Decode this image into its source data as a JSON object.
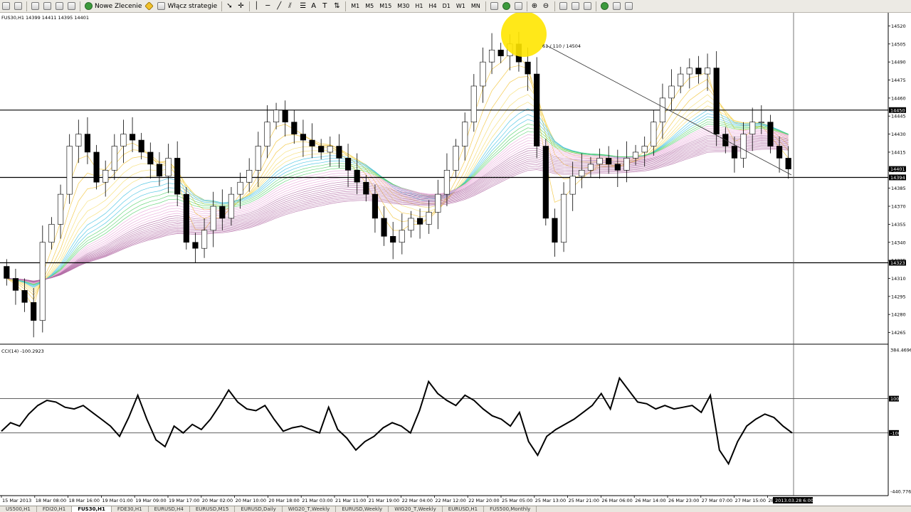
{
  "toolbar": {
    "new_order_label": "Nowe Zlecenie",
    "autotrading_label": "Włącz strategie",
    "timeframes": [
      "M1",
      "M5",
      "M15",
      "M30",
      "H1",
      "H4",
      "D1",
      "W1",
      "MN"
    ]
  },
  "main_chart": {
    "header": "FUS30,H1  14399 14411 14395 14401",
    "annotation": "61 / 110 / 14504",
    "price_ticks": [
      "14520",
      "14505",
      "14490",
      "14475",
      "14460",
      "14445",
      "14430",
      "14415",
      "14400",
      "14385",
      "14370",
      "14355",
      "14340",
      "14325",
      "14310",
      "14295",
      "14280",
      "14265"
    ],
    "price_tags": [
      "14450",
      "14401",
      "14394",
      "14323"
    ]
  },
  "indicator": {
    "header": "CCI(14) -100.2923",
    "ticks": [
      "384.4696",
      "100",
      "-100",
      "-440.7765"
    ]
  },
  "time_axis": {
    "labels": [
      "15 Mar 2013",
      "18 Mar 08:00",
      "18 Mar 16:00",
      "19 Mar 01:00",
      "19 Mar 09:00",
      "19 Mar 17:00",
      "20 Mar 02:00",
      "20 Mar 10:00",
      "20 Mar 18:00",
      "21 Mar 03:00",
      "21 Mar 11:00",
      "21 Mar 19:00",
      "22 Mar 04:00",
      "22 Mar 12:00",
      "22 Mar 20:00",
      "25 Mar 05:00",
      "25 Mar 13:00",
      "25 Mar 21:00",
      "26 Mar 06:00",
      "26 Mar 14:00",
      "26 Mar 23:00",
      "27 Mar 07:00",
      "27 Mar 15:00",
      "28"
    ],
    "cursor_label": "2013.03.28 6:00"
  },
  "tabs": [
    "US500,H1",
    "FDI20,H1",
    "FUS30,H1",
    "FDE30,H1",
    "EURUSD,H4",
    "EURUSD,M15",
    "EURUSD,Daily",
    "WIG20_T,Weekly",
    "EURUSD,Weekly",
    "WIG20_T,Weekly",
    "EURUSD,H1",
    "FUS500,Monthly"
  ],
  "active_tab": 2,
  "chart_data": {
    "type": "candlestick",
    "symbol": "FUS30",
    "timeframe": "H1",
    "ylim": [
      14260,
      14525
    ],
    "horizontal_levels": [
      14450,
      14394,
      14323
    ],
    "closes": [
      14310,
      14300,
      14290,
      14275,
      14340,
      14355,
      14380,
      14420,
      14430,
      14415,
      14390,
      14400,
      14420,
      14430,
      14425,
      14415,
      14405,
      14395,
      14410,
      14380,
      14340,
      14335,
      14350,
      14370,
      14360,
      14380,
      14390,
      14400,
      14420,
      14440,
      14450,
      14440,
      14430,
      14425,
      14420,
      14415,
      14420,
      14410,
      14400,
      14390,
      14380,
      14360,
      14345,
      14340,
      14350,
      14360,
      14355,
      14365,
      14380,
      14400,
      14420,
      14440,
      14470,
      14490,
      14500,
      14495,
      14505,
      14490,
      14480,
      14420,
      14360,
      14340,
      14380,
      14395,
      14400,
      14405,
      14410,
      14405,
      14400,
      14410,
      14415,
      14420,
      14440,
      14460,
      14470,
      14480,
      14485,
      14480,
      14485,
      14430,
      14420,
      14410,
      14430,
      14440,
      14440,
      14420,
      14410,
      14401
    ],
    "cci_ylim": [
      -440.7765,
      384.4696
    ],
    "cci_levels": [
      100,
      -100
    ],
    "cci": [
      -90,
      -40,
      -60,
      10,
      60,
      90,
      80,
      50,
      40,
      60,
      20,
      -20,
      -60,
      -120,
      -10,
      120,
      -20,
      -140,
      -180,
      -60,
      -100,
      -50,
      -80,
      -20,
      60,
      150,
      80,
      40,
      30,
      60,
      -20,
      -90,
      -70,
      -60,
      -80,
      -100,
      50,
      -80,
      -130,
      -200,
      -150,
      -120,
      -70,
      -40,
      -60,
      -100,
      30,
      200,
      130,
      90,
      60,
      120,
      90,
      40,
      0,
      -20,
      -60,
      20,
      -150,
      -230,
      -120,
      -80,
      -50,
      -20,
      20,
      60,
      130,
      40,
      220,
      150,
      80,
      70,
      40,
      60,
      40,
      50,
      60,
      20,
      120,
      -200,
      -280,
      -150,
      -60,
      -20,
      10,
      -10,
      -60,
      -100
    ]
  }
}
